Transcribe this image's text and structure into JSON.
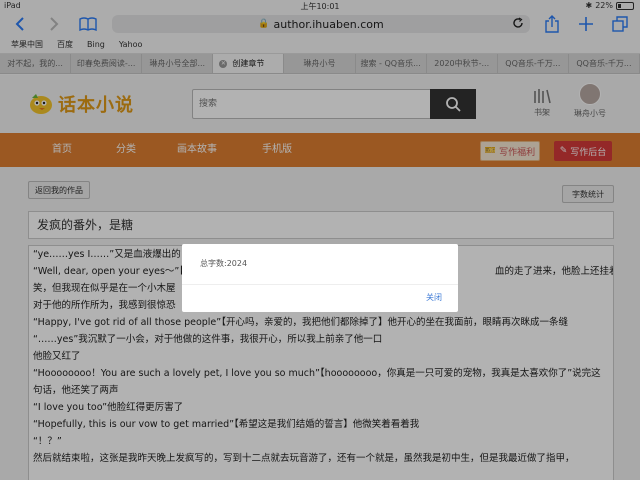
{
  "status_bar": {
    "device": "iPad",
    "time": "上午10:01",
    "battery": "22%",
    "battery_level": 0.22
  },
  "browser": {
    "url": "author.ihuaben.com",
    "favorites": [
      "苹果中国",
      "百度",
      "Bing",
      "Yahoo"
    ],
    "tabs": [
      {
        "label": "对不起，我的...",
        "active": false
      },
      {
        "label": "印春免费阅读-...",
        "active": false
      },
      {
        "label": "琳舟小号全部...",
        "active": false
      },
      {
        "label": "创建章节",
        "active": true
      },
      {
        "label": "琳舟小号",
        "active": false
      },
      {
        "label": "搜索 - QQ音乐...",
        "active": false
      },
      {
        "label": "2020中秋节-...",
        "active": false
      },
      {
        "label": "QQ音乐-千万...",
        "active": false
      },
      {
        "label": "QQ音乐-千万...",
        "active": false
      }
    ]
  },
  "site": {
    "logo_text": "话本小说",
    "search_placeholder": "搜索",
    "shelf_label": "书架",
    "username": "琳舟小号",
    "nav": [
      "首页",
      "分类",
      "画本故事",
      "手机版"
    ],
    "welfare_label": "写作福利",
    "backend_label": "写作后台"
  },
  "editor": {
    "back_label": "返回我的作品",
    "wordcount_label": "字数统计",
    "chapter_title": "发疯的番外，是糖",
    "lines": [
      "“ye……yes I……”又是血液爆出的",
      "“Well, dear, open your eyes～”【好",
      "笑，但我现在似乎是在一个小木屋",
      "对于他的所作所为，我感到很惊恐",
      "“Happy, I've got rid of all those people”【开心吗，亲爱的，我把他们都除掉了】他开心的坐在我面前，眼睛再次眯成一条缝",
      "“……yes”我沉默了一小会，对于他做的这件事，我很开心，所以我上前亲了他一口",
      "他脸又红了",
      "“Hoooooooo！You are such a lovely pet, I love you so much”【hoooooooo，你真是一只可爱的宠物，我真是太喜欢你了”说完这",
      "句话，他还笑了两声",
      "“I love you too”他脸红得更厉害了",
      "“Hopefully, this is our vow to get married”【希望这是我们结婚的誓言】他微笑着看着我",
      "“！？”",
      "然后就结束啦，这张是我昨天晚上发疯写的，写到十二点就去玩音游了，还有一个就是，虽然我是初中生，但是我最近做了指甲，"
    ],
    "right_fragments": [
      "血的走了进来，他脸上还挂着微"
    ]
  },
  "dialog": {
    "message": "总字数:2024",
    "close_label": "关闭"
  }
}
